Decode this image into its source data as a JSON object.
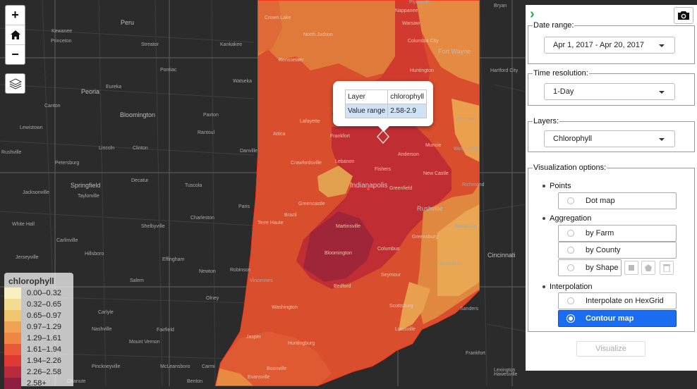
{
  "map": {
    "labels": [
      {
        "text": "Peru",
        "cls": "city"
      },
      {
        "text": "Kewanee",
        "cls": ""
      },
      {
        "text": "Princeton",
        "cls": ""
      },
      {
        "text": "Streator",
        "cls": ""
      },
      {
        "text": "Kankakee",
        "cls": ""
      },
      {
        "text": "Pontiac",
        "cls": ""
      },
      {
        "text": "Peoria",
        "cls": "city"
      },
      {
        "text": "Eureka",
        "cls": ""
      },
      {
        "text": "Watseka",
        "cls": ""
      },
      {
        "text": "Canton",
        "cls": ""
      },
      {
        "text": "Bloomington",
        "cls": "city"
      },
      {
        "text": "Paxton",
        "cls": ""
      },
      {
        "text": "Lewistown",
        "cls": ""
      },
      {
        "text": "Clinton",
        "cls": ""
      },
      {
        "text": "Rantoul",
        "cls": ""
      },
      {
        "text": "Lincoln",
        "cls": ""
      },
      {
        "text": "Rushville",
        "cls": ""
      },
      {
        "text": "Petersburg",
        "cls": ""
      },
      {
        "text": "Danville",
        "cls": ""
      },
      {
        "text": "Springfield",
        "cls": "city"
      },
      {
        "text": "Decatur",
        "cls": ""
      },
      {
        "text": "Tuscola",
        "cls": ""
      },
      {
        "text": "Jacksonville",
        "cls": ""
      },
      {
        "text": "Taylorville",
        "cls": ""
      },
      {
        "text": "Paris",
        "cls": ""
      },
      {
        "text": "Charleston",
        "cls": ""
      },
      {
        "text": "Carlinville",
        "cls": ""
      },
      {
        "text": "Shelbyville",
        "cls": ""
      },
      {
        "text": "White Hall",
        "cls": ""
      },
      {
        "text": "Hillsboro",
        "cls": ""
      },
      {
        "text": "Jerseyville",
        "cls": ""
      },
      {
        "text": "Effingham",
        "cls": ""
      },
      {
        "text": "Newton",
        "cls": ""
      },
      {
        "text": "Robinson",
        "cls": ""
      },
      {
        "text": "Salem",
        "cls": ""
      },
      {
        "text": "Olney",
        "cls": ""
      },
      {
        "text": "Carlyle",
        "cls": ""
      },
      {
        "text": "Nashville",
        "cls": ""
      },
      {
        "text": "Fairfield",
        "cls": ""
      },
      {
        "text": "Mount Vernon",
        "cls": ""
      },
      {
        "text": "Pinckneyville",
        "cls": ""
      },
      {
        "text": "McLeansboro",
        "cls": ""
      },
      {
        "text": "Carmi",
        "cls": ""
      },
      {
        "text": "Benton",
        "cls": ""
      },
      {
        "text": "Chanute",
        "cls": ""
      },
      {
        "text": "Plymouth",
        "cls": ""
      },
      {
        "text": "Crown Lake",
        "cls": "inside"
      },
      {
        "text": "North Judson",
        "cls": "inside"
      },
      {
        "text": "Rensselaer",
        "cls": "inside"
      },
      {
        "text": "Nappanee",
        "cls": "inside"
      },
      {
        "text": "Warsaw",
        "cls": "inside"
      },
      {
        "text": "Columbia City",
        "cls": "inside"
      },
      {
        "text": "Fort Wayne",
        "cls": "city"
      },
      {
        "text": "Huntington",
        "cls": "inside"
      },
      {
        "text": "Hartford City",
        "cls": ""
      },
      {
        "text": "Lafayette",
        "cls": "inside"
      },
      {
        "text": "Frankfort",
        "cls": "inside"
      },
      {
        "text": "Portland",
        "cls": ""
      },
      {
        "text": "Muncie",
        "cls": "inside"
      },
      {
        "text": "Winchester",
        "cls": ""
      },
      {
        "text": "Attica",
        "cls": "inside"
      },
      {
        "text": "Crawfordsville",
        "cls": "inside"
      },
      {
        "text": "Lebanon",
        "cls": "inside"
      },
      {
        "text": "Anderson",
        "cls": "inside"
      },
      {
        "text": "Fishers",
        "cls": "inside"
      },
      {
        "text": "New Castle",
        "cls": "inside"
      },
      {
        "text": "Indianapolis",
        "cls": "big"
      },
      {
        "text": "Greenfield",
        "cls": "inside"
      },
      {
        "text": "Richmond",
        "cls": ""
      },
      {
        "text": "Greencastle",
        "cls": "inside"
      },
      {
        "text": "Brazil",
        "cls": "inside"
      },
      {
        "text": "Terre Haute",
        "cls": "inside"
      },
      {
        "text": "Rushville",
        "cls": "city"
      },
      {
        "text": "Martinsville",
        "cls": "inside"
      },
      {
        "text": "Bloomington",
        "cls": "inside"
      },
      {
        "text": "Columbus",
        "cls": "inside"
      },
      {
        "text": "Greensburg",
        "cls": "inside"
      },
      {
        "text": "Brookville",
        "cls": ""
      },
      {
        "text": "Seymour",
        "cls": "inside"
      },
      {
        "text": "Versailles",
        "cls": ""
      },
      {
        "text": "Bedford",
        "cls": "inside"
      },
      {
        "text": "Cincinnati",
        "cls": "city"
      },
      {
        "text": "Vincennes",
        "cls": ""
      },
      {
        "text": "Washington",
        "cls": "inside"
      },
      {
        "text": "Scottsburg",
        "cls": "inside"
      },
      {
        "text": "Sanders",
        "cls": ""
      },
      {
        "text": "Jasper",
        "cls": "inside"
      },
      {
        "text": "Huntingburg",
        "cls": "inside"
      },
      {
        "text": "Louisville",
        "cls": "inside"
      },
      {
        "text": "Frankfort",
        "cls": ""
      },
      {
        "text": "Lexington",
        "cls": ""
      },
      {
        "text": "Boonville",
        "cls": "inside"
      },
      {
        "text": "Evansville",
        "cls": "inside"
      },
      {
        "text": "Hawesville",
        "cls": ""
      },
      {
        "text": "Bryan",
        "cls": ""
      }
    ]
  },
  "controls": {
    "zoom_in": "+",
    "home": "home-icon",
    "zoom_out": "−",
    "layers": "layers-icon"
  },
  "legend": {
    "title": "chlorophyll",
    "entries": [
      {
        "label": "0.00–0.32",
        "color": "#f7f0c0"
      },
      {
        "label": "0.32–0.65",
        "color": "#f3dc92"
      },
      {
        "label": "0.65–0.97",
        "color": "#efc66d"
      },
      {
        "label": "0.97–1.29",
        "color": "#f0a354"
      },
      {
        "label": "1.29–1.61",
        "color": "#ee8743"
      },
      {
        "label": "1.61–1.94",
        "color": "#e85a37"
      },
      {
        "label": "1.94–2.26",
        "color": "#dc3a33"
      },
      {
        "label": "2.26–2.58",
        "color": "#b92b3c"
      },
      {
        "label": "2.58+",
        "color": "#8e1f41"
      }
    ]
  },
  "popup": {
    "rows": [
      {
        "key": "Layer",
        "value": "chlorophyll"
      },
      {
        "key": "Value range",
        "value": "2.58-2.9"
      }
    ]
  },
  "panel": {
    "date_range": {
      "legend": "Date range:",
      "value": "Apr 1, 2017 - Apr 20, 2017"
    },
    "time_resolution": {
      "legend": "Time resolution:",
      "value": "1-Day"
    },
    "layers": {
      "legend": "Layers:",
      "value": "Chlorophyll"
    },
    "viz": {
      "legend": "Visualization options:",
      "points": "Points",
      "dot_map": "Dot map",
      "aggregation": "Aggregation",
      "by_farm": "by Farm",
      "by_county": "by County",
      "by_shape": "by Shape",
      "interpolation": "Interpolation",
      "hexgrid": "Interpolate on HexGrid",
      "contour": "Contour map"
    },
    "visualize": "Visualize"
  }
}
